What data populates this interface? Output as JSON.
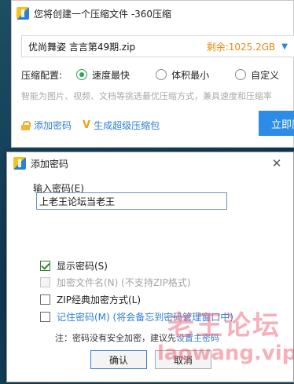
{
  "background_window": {
    "title": "您将创建一个压缩文件 -360压缩",
    "file_name": "优尚舞姿 言言第49期.zip",
    "free_space": "剩余:1025.2GB",
    "level_label": "压缩配置:",
    "levels": [
      "速度最快",
      "体积最小",
      "自定义"
    ],
    "selected_level": "速度最快",
    "hint": "智能为图片、视频、文档等挑选最优压缩方式，兼具速度和压缩率",
    "add_password_link": "添加密码",
    "super_zip_link": "生成超级压缩包",
    "compress_now_button": "立即压缩"
  },
  "dialog": {
    "title": "添加密码",
    "input_label": "输入密码(E)",
    "password_value": "上老王论坛当老王",
    "show_password": {
      "label": "显示密码(S)",
      "checked": true
    },
    "encrypt_filenames": {
      "label": "加密文件名(N) (不支持ZIP格式)",
      "checked": false,
      "disabled": true
    },
    "zip_classic": {
      "label": "ZIP经典加密方式(L)",
      "checked": false
    },
    "remember_password": {
      "label": "记住密码(M) (将会备忘到密码管理窗口中)",
      "checked": false
    },
    "note_prefix": "注：密码没有安全加密，建议先",
    "note_link": "设置主密码",
    "ok_button": "确认",
    "cancel_button": "取消"
  },
  "watermark": {
    "chinese": "老王论坛",
    "domain": "laowang.vip"
  }
}
